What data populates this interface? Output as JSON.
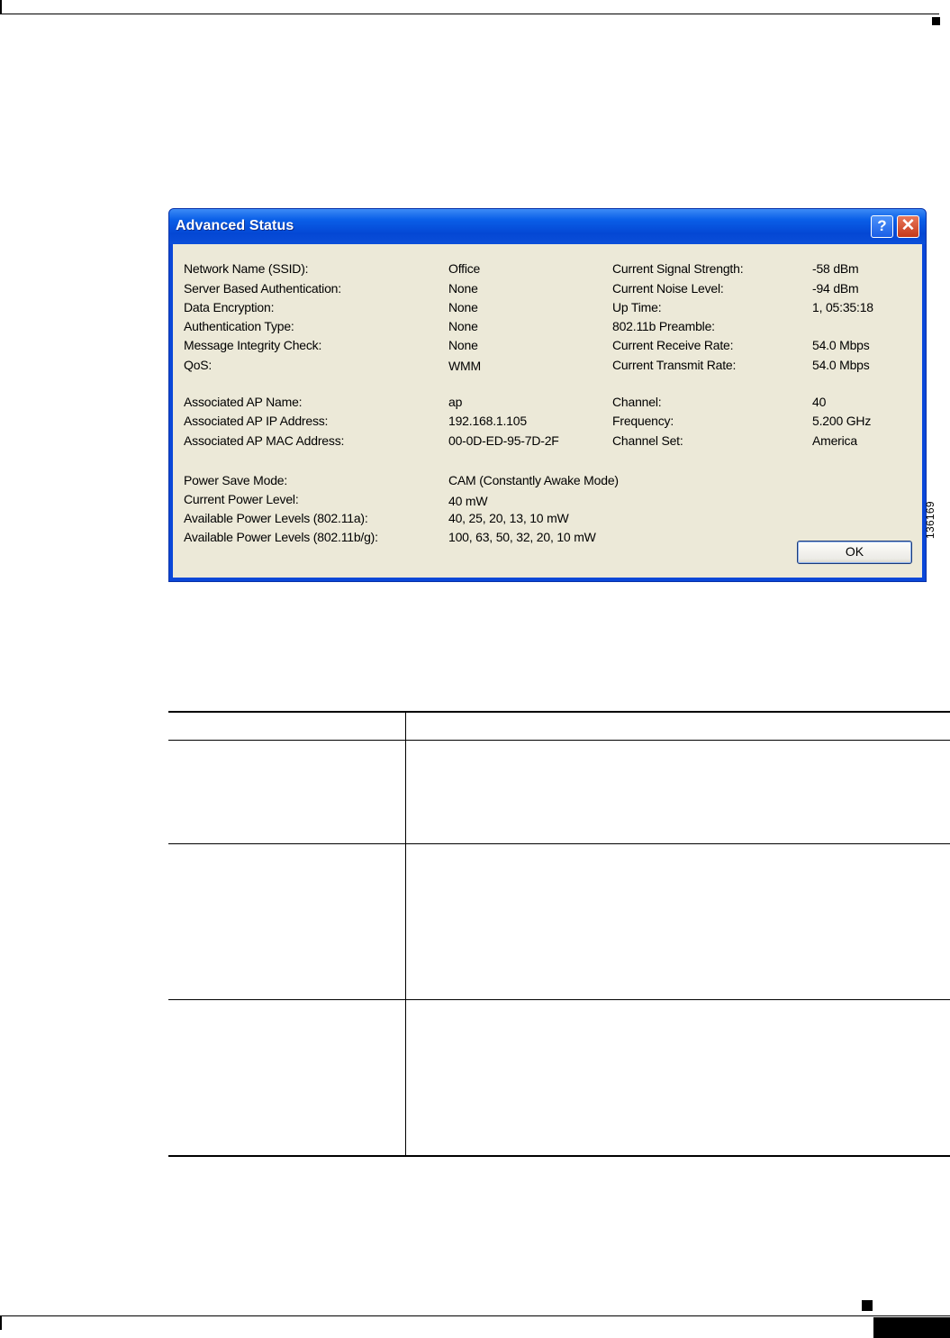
{
  "dialog": {
    "title": "Advanced Status",
    "help_label": "?",
    "close_label": "✕",
    "ok_label": "OK",
    "left_labels": [
      "Network Name (SSID):",
      "Server Based Authentication:",
      "Data Encryption:",
      "Authentication Type:",
      "Message Integrity Check:",
      "QoS:",
      "Associated AP Name:",
      "Associated AP IP Address:",
      "Associated AP MAC Address:",
      "Power Save Mode:",
      "Current Power Level:",
      "Available Power Levels (802.11a):",
      "Available Power Levels (802.11b/g):"
    ],
    "left_values": [
      "Office",
      "None",
      "None",
      "None",
      "None",
      "WMM",
      "ap",
      "192.168.1.105",
      "00-0D-ED-95-7D-2F",
      "CAM (Constantly Awake Mode)",
      "40 mW",
      "40, 25, 20, 13, 10 mW",
      "100, 63, 50, 32, 20, 10 mW"
    ],
    "right_labels": [
      "Current Signal Strength:",
      "Current Noise Level:",
      "Up Time:",
      "802.11b Preamble:",
      "Current Receive Rate:",
      "Current Transmit Rate:",
      "Channel:",
      "Frequency:",
      "Channel Set:"
    ],
    "right_values": [
      "-58 dBm",
      "-94 dBm",
      "1, 05:35:18",
      "",
      "54.0 Mbps",
      "54.0 Mbps",
      "40",
      "5.200 GHz",
      "America"
    ]
  },
  "figure_number": "136169"
}
